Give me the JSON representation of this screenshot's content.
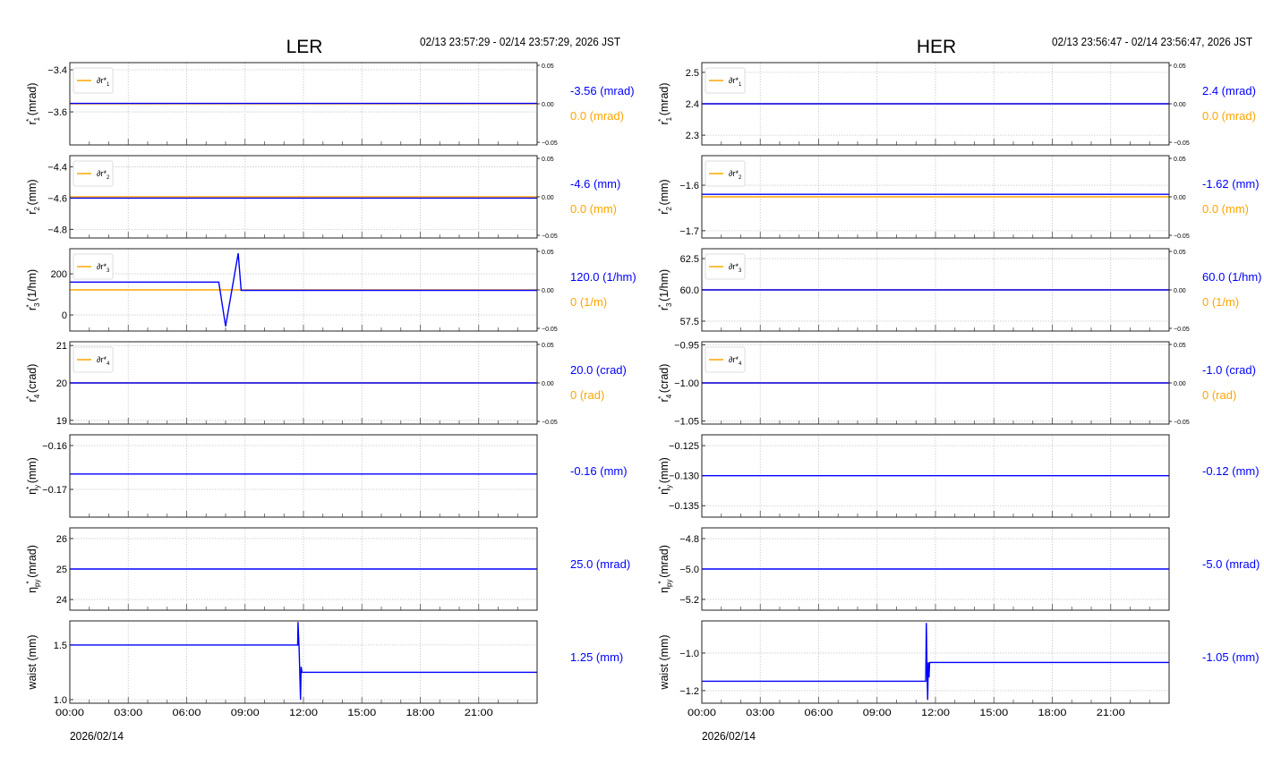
{
  "chart_data": [
    {
      "type": "line",
      "title": "LER",
      "time_range": "02/13 23:57:29 - 02/14 23:57:29, 2026 JST",
      "date_label": "2026/02/14",
      "xlim": [
        0,
        24
      ],
      "xticks": [
        0,
        3,
        6,
        9,
        12,
        15,
        18,
        21
      ],
      "xtick_labels": [
        "00:00",
        "03:00",
        "06:00",
        "09:00",
        "12:00",
        "15:00",
        "18:00",
        "21:00"
      ],
      "colors": {
        "value": "#0000ff",
        "delta": "#ffa500"
      },
      "panels": [
        {
          "ylabel": {
            "base": "r",
            "sup": "*",
            "sub": "1",
            "unit": " (mrad)"
          },
          "ylim": [
            -3.757,
            -3.366
          ],
          "yticks": [
            -3.4,
            -3.6
          ],
          "ytick_labels": [
            "−3.4",
            "−3.6"
          ],
          "series": [
            [
              0,
              -3.56
            ],
            [
              24,
              -3.56
            ]
          ],
          "legend": "∂r*1",
          "delta_axis": true,
          "right_ticks": [
            "0.05",
            "0.00",
            "−0.05"
          ],
          "value_label": "-3.56 (mrad)",
          "delta_label": "0.0 (mrad)"
        },
        {
          "ylabel": {
            "base": "r",
            "sup": "*",
            "sub": "2",
            "unit": " (mm)"
          },
          "ylim": [
            -4.855,
            -4.329
          ],
          "yticks": [
            -4.4,
            -4.6,
            -4.8
          ],
          "ytick_labels": [
            "−4.4",
            "−4.6",
            "−4.8"
          ],
          "series": [
            [
              0,
              -4.6
            ],
            [
              24,
              -4.6
            ]
          ],
          "legend": "∂r*2",
          "delta_axis": true,
          "right_ticks": [
            "0.05",
            "0.00",
            "−0.05"
          ],
          "value_label": "-4.6 (mm)",
          "delta_label": "0.0 (mm)"
        },
        {
          "ylabel": {
            "base": "r",
            "sup": "*",
            "sub": "3",
            "unit": " (1/hm)"
          },
          "ylim": [
            -78,
            322
          ],
          "yticks": [
            200,
            0
          ],
          "ytick_labels": [
            "200",
            "0"
          ],
          "series": [
            [
              0,
              160
            ],
            [
              7.65,
              160
            ],
            [
              8.0,
              -55
            ],
            [
              8.65,
              300
            ],
            [
              8.8,
              120
            ],
            [
              24,
              120
            ]
          ],
          "legend": "∂r*3",
          "delta_axis": true,
          "right_ticks": [
            "0.05",
            "0.00",
            "−0.05"
          ],
          "value_label": "120.0 (1/hm)",
          "delta_label": "0 (1/m)"
        },
        {
          "ylabel": {
            "base": "r",
            "sup": "*",
            "sub": "4",
            "unit": " (crad)"
          },
          "ylim": [
            18.9,
            21.1
          ],
          "yticks": [
            21,
            20,
            19
          ],
          "ytick_labels": [
            "21",
            "20",
            "19"
          ],
          "series": [
            [
              0,
              20
            ],
            [
              24,
              20
            ]
          ],
          "legend": "∂r*4",
          "delta_axis": true,
          "right_ticks": [
            "0.05",
            "0.00",
            "−0.05"
          ],
          "value_label": "20.0 (crad)",
          "delta_label": "0 (rad)"
        },
        {
          "ylabel": {
            "base": "η",
            "sup": "*",
            "sub": "y",
            "unit": " (mm)"
          },
          "ylim": [
            -0.17633,
            -0.15755
          ],
          "yticks": [
            -0.16,
            -0.17
          ],
          "ytick_labels": [
            "−0.16",
            "−0.17"
          ],
          "series": [
            [
              0,
              -0.1665
            ],
            [
              24,
              -0.1665
            ]
          ],
          "delta_axis": false,
          "value_label": "-0.16 (mm)"
        },
        {
          "ylabel": {
            "base": "η",
            "sup": "*",
            "sub": "py",
            "unit": " (mrad)"
          },
          "ylim": [
            23.65,
            26.35
          ],
          "yticks": [
            26,
            25,
            24
          ],
          "ytick_labels": [
            "26",
            "25",
            "24"
          ],
          "series": [
            [
              0,
              25
            ],
            [
              24,
              25
            ]
          ],
          "delta_axis": false,
          "value_label": "25.0 (mrad)"
        },
        {
          "ylabel": {
            "base": "waist",
            "sup": "",
            "sub": "",
            "unit": " (mm)"
          },
          "ylim": [
            0.967,
            1.72
          ],
          "yticks": [
            1.5,
            1.0
          ],
          "ytick_labels": [
            "1.5",
            "1.0"
          ],
          "series": [
            [
              0,
              1.5
            ],
            [
              11.7,
              1.5
            ],
            [
              11.72,
              1.71
            ],
            [
              11.78,
              1.45
            ],
            [
              11.85,
              1.0
            ],
            [
              11.88,
              1.3
            ],
            [
              11.92,
              1.25
            ],
            [
              24,
              1.25
            ]
          ],
          "delta_axis": false,
          "value_label": "1.25 (mm)"
        }
      ]
    },
    {
      "type": "line",
      "title": "HER",
      "time_range": "02/13 23:56:47 - 02/14 23:56:47, 2026 JST",
      "date_label": "2026/02/14",
      "xlim": [
        0,
        24
      ],
      "xticks": [
        0,
        3,
        6,
        9,
        12,
        15,
        18,
        21
      ],
      "xtick_labels": [
        "00:00",
        "03:00",
        "06:00",
        "09:00",
        "12:00",
        "15:00",
        "18:00",
        "21:00"
      ],
      "colors": {
        "value": "#0000ff",
        "delta": "#ffa500"
      },
      "panels": [
        {
          "ylabel": {
            "base": "r",
            "sup": "*",
            "sub": "1",
            "unit": " (mrad)"
          },
          "ylim": [
            2.269,
            2.531
          ],
          "yticks": [
            2.5,
            2.4,
            2.3
          ],
          "ytick_labels": [
            "2.5",
            "2.4",
            "2.3"
          ],
          "series": [
            [
              0,
              2.4
            ],
            [
              24,
              2.4
            ]
          ],
          "legend": "∂r*1",
          "delta_axis": true,
          "right_ticks": [
            "0.05",
            "0.00",
            "−0.05"
          ],
          "value_label": "2.4 (mrad)",
          "delta_label": "0.0 (mrad)"
        },
        {
          "ylabel": {
            "base": "r",
            "sup": "*",
            "sub": "2",
            "unit": " (mm)"
          },
          "ylim": [
            -1.716,
            -1.535
          ],
          "yticks": [
            -1.6,
            -1.7
          ],
          "ytick_labels": [
            "−1.6",
            "−1.7"
          ],
          "series": [
            [
              0,
              -1.62
            ],
            [
              24,
              -1.62
            ]
          ],
          "legend": "∂r*2",
          "delta_axis": true,
          "right_ticks": [
            "0.05",
            "0.00",
            "−0.05"
          ],
          "value_label": "-1.62 (mm)",
          "delta_label": "0.0 (mm)"
        },
        {
          "ylabel": {
            "base": "r",
            "sup": "*",
            "sub": "3",
            "unit": " (1/hm)"
          },
          "ylim": [
            56.71,
            63.29
          ],
          "yticks": [
            62.5,
            60.0,
            57.5
          ],
          "ytick_labels": [
            "62.5",
            "60.0",
            "57.5"
          ],
          "series": [
            [
              0,
              60
            ],
            [
              24,
              60
            ]
          ],
          "legend": "∂r*3",
          "delta_axis": true,
          "right_ticks": [
            "0.05",
            "0.00",
            "−0.05"
          ],
          "value_label": "60.0 (1/hm)",
          "delta_label": "0 (1/m)"
        },
        {
          "ylabel": {
            "base": "r",
            "sup": "*",
            "sub": "4",
            "unit": " (crad)"
          },
          "ylim": [
            -1.054,
            -0.946
          ],
          "yticks": [
            -0.95,
            -1.0,
            -1.05
          ],
          "ytick_labels": [
            "−0.95",
            "−1.00",
            "−1.05"
          ],
          "series": [
            [
              0,
              -1.0
            ],
            [
              24,
              -1.0
            ]
          ],
          "legend": "∂r*4",
          "delta_axis": true,
          "right_ticks": [
            "0.05",
            "0.00",
            "−0.05"
          ],
          "value_label": "-1.0 (crad)",
          "delta_label": "0 (rad)"
        },
        {
          "ylabel": {
            "base": "η",
            "sup": "*",
            "sub": "y",
            "unit": " (mm)"
          },
          "ylim": [
            -0.1369,
            -0.1232
          ],
          "yticks": [
            -0.125,
            -0.13,
            -0.135
          ],
          "ytick_labels": [
            "−0.125",
            "−0.130",
            "−0.135"
          ],
          "series": [
            [
              0,
              -0.13
            ],
            [
              24,
              -0.13
            ]
          ],
          "delta_axis": false,
          "value_label": "-0.12 (mm)"
        },
        {
          "ylabel": {
            "base": "η",
            "sup": "*",
            "sub": "py",
            "unit": " (mrad)"
          },
          "ylim": [
            -5.271,
            -4.729
          ],
          "yticks": [
            -4.8,
            -5.0,
            -5.2
          ],
          "ytick_labels": [
            "−4.8",
            "−5.0",
            "−5.2"
          ],
          "series": [
            [
              0,
              -5.0
            ],
            [
              24,
              -5.0
            ]
          ],
          "delta_axis": false,
          "value_label": "-5.0 (mrad)"
        },
        {
          "ylabel": {
            "base": "waist",
            "sup": "",
            "sub": "",
            "unit": " (mm)"
          },
          "ylim": [
            -1.267,
            -0.829
          ],
          "yticks": [
            -1.0,
            -1.2
          ],
          "ytick_labels": [
            "−1.0",
            "−1.2"
          ],
          "series": [
            [
              0,
              -1.15
            ],
            [
              11.5,
              -1.15
            ],
            [
              11.53,
              -0.84
            ],
            [
              11.57,
              -1.1
            ],
            [
              11.6,
              -1.25
            ],
            [
              11.63,
              -1.05
            ],
            [
              11.67,
              -1.13
            ],
            [
              11.7,
              -1.05
            ],
            [
              24,
              -1.05
            ]
          ],
          "delta_axis": false,
          "value_label": "-1.05 (mm)"
        }
      ]
    }
  ]
}
